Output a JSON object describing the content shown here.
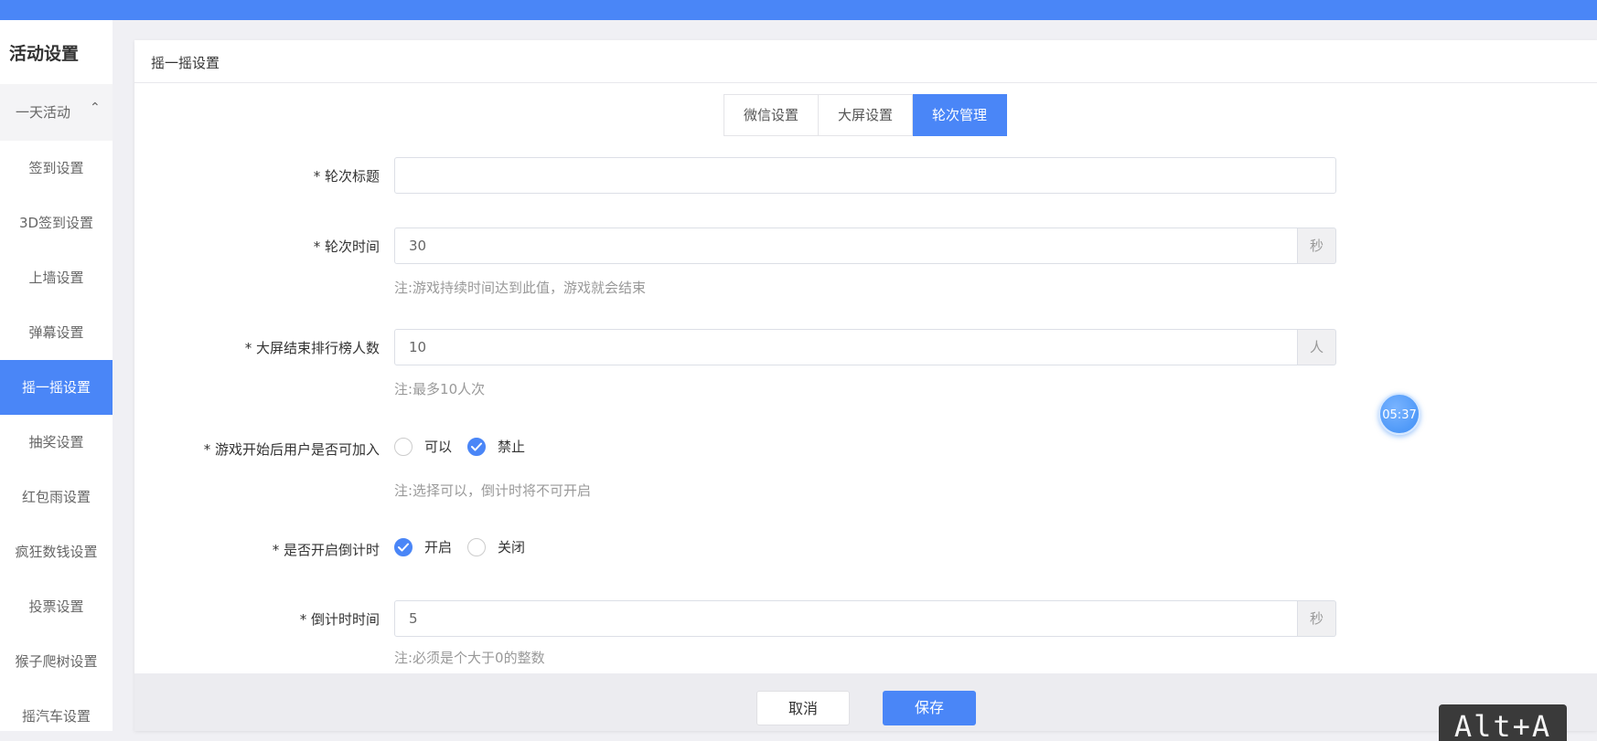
{
  "sidebar": {
    "title": "活动设置",
    "group_label": "一天活动",
    "items": [
      {
        "label": "签到设置"
      },
      {
        "label": "3D签到设置"
      },
      {
        "label": "上墙设置"
      },
      {
        "label": "弹幕设置"
      },
      {
        "label": "摇一摇设置",
        "active": true
      },
      {
        "label": "抽奖设置"
      },
      {
        "label": "红包雨设置"
      },
      {
        "label": "疯狂数钱设置"
      },
      {
        "label": "投票设置"
      },
      {
        "label": "猴子爬树设置"
      },
      {
        "label": "摇汽车设置"
      }
    ]
  },
  "card": {
    "title": "摇一摇设置",
    "tabs": [
      {
        "label": "微信设置"
      },
      {
        "label": "大屏设置"
      },
      {
        "label": "轮次管理",
        "active": true
      }
    ]
  },
  "form": {
    "round_title": {
      "label": "* 轮次标题",
      "value": ""
    },
    "round_time": {
      "label": "* 轮次时间",
      "value": "30",
      "unit": "秒",
      "note": "注:游戏持续时间达到此值，游戏就会结束"
    },
    "rank_count": {
      "label": "* 大屏结束排行榜人数",
      "value": "10",
      "unit": "人",
      "note": "注:最多10人次"
    },
    "join_after_start": {
      "label": "* 游戏开始后用户是否可加入",
      "options": [
        {
          "label": "可以",
          "checked": false
        },
        {
          "label": "禁止",
          "checked": true
        }
      ],
      "note": "注:选择可以，倒计时将不可开启"
    },
    "countdown_enabled": {
      "label": "* 是否开启倒计时",
      "options": [
        {
          "label": "开启",
          "checked": true
        },
        {
          "label": "关闭",
          "checked": false
        }
      ]
    },
    "countdown_time": {
      "label": "* 倒计时时间",
      "value": "5",
      "unit": "秒",
      "note": "注:必须是个大于0的整数"
    }
  },
  "footer": {
    "cancel_label": "取消",
    "save_label": "保存"
  },
  "timer_badge": "05:37",
  "shortcut_overlay": "Alt+A",
  "colors": {
    "accent": "#4a86f7"
  }
}
